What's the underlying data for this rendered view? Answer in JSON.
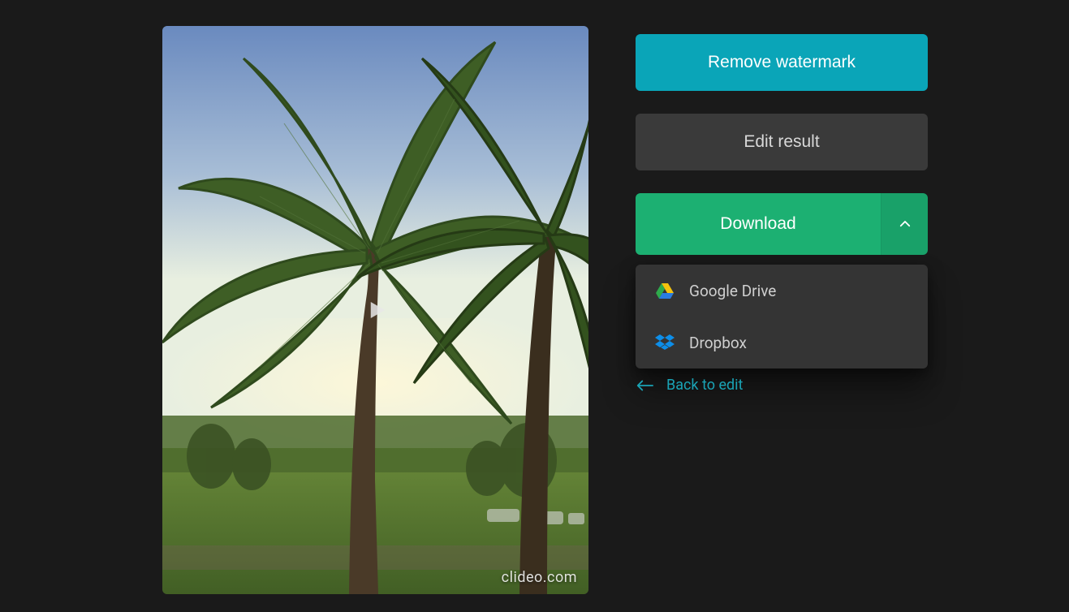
{
  "preview": {
    "watermark": "clideo.com"
  },
  "actions": {
    "remove_watermark": "Remove watermark",
    "edit_result": "Edit result",
    "download": "Download"
  },
  "download_options": {
    "google_drive": "Google Drive",
    "dropbox": "Dropbox"
  },
  "back_link": "Back to edit",
  "colors": {
    "teal": "#0aa5b8",
    "green": "#1cb072",
    "panel_dark": "#3a3a3a",
    "bg": "#1a1a1a"
  }
}
